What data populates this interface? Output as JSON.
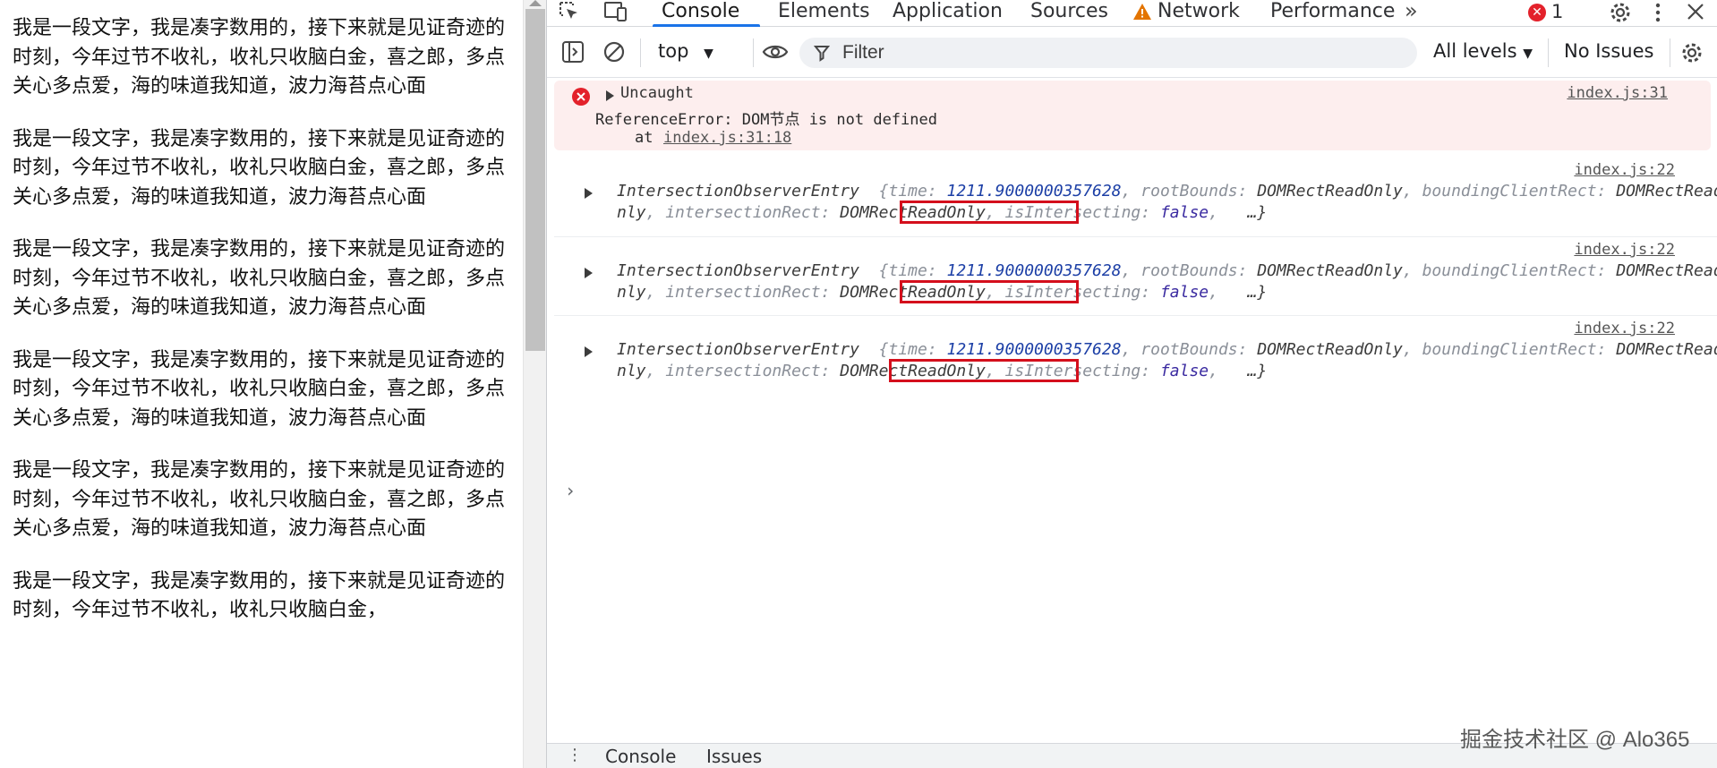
{
  "page": {
    "paragraphs": [
      "我是一段文字，我是凑字数用的，接下来就是见证奇迹的时刻，今年过节不收礼，收礼只收脑白金，喜之郎，多点关心多点爱，海的味道我知道，波力海苔点心面",
      "我是一段文字，我是凑字数用的，接下来就是见证奇迹的时刻，今年过节不收礼，收礼只收脑白金，喜之郎，多点关心多点爱，海的味道我知道，波力海苔点心面",
      "我是一段文字，我是凑字数用的，接下来就是见证奇迹的时刻，今年过节不收礼，收礼只收脑白金，喜之郎，多点关心多点爱，海的味道我知道，波力海苔点心面",
      "我是一段文字，我是凑字数用的，接下来就是见证奇迹的时刻，今年过节不收礼，收礼只收脑白金，喜之郎，多点关心多点爱，海的味道我知道，波力海苔点心面",
      "我是一段文字，我是凑字数用的，接下来就是见证奇迹的时刻，今年过节不收礼，收礼只收脑白金，喜之郎，多点关心多点爱，海的味道我知道，波力海苔点心面",
      "我是一段文字，我是凑字数用的，接下来就是见证奇迹的时刻，今年过节不收礼，收礼只收脑白金，"
    ]
  },
  "devtools": {
    "tabs": [
      {
        "label": "Console",
        "active": true
      },
      {
        "label": "Elements"
      },
      {
        "label": "Application"
      },
      {
        "label": "Sources"
      },
      {
        "label": "Network",
        "warning": true
      },
      {
        "label": "Performance"
      }
    ],
    "more_tabs": "»",
    "error_count": "1",
    "toolbar": {
      "context": "top",
      "filter_placeholder": "Filter",
      "levels": "All levels",
      "issues": "No Issues"
    },
    "error": {
      "title": "Uncaught",
      "message": "ReferenceError: DOM节点 is not defined",
      "at_prefix": "at",
      "at_link": "index.js:31:18",
      "source": "index.js:31"
    },
    "logs": [
      {
        "source": "index.js:22",
        "type_name": "IntersectionObserverEntry",
        "time_key": "time:",
        "time_val": "1211.9000000357628",
        "rootBounds_key": "rootBounds:",
        "rootBounds_val": "DOMRectReadOnly",
        "bcr_key": "boundingClientRect:",
        "bcr_val": "DOMRectReadO",
        "bcr_val2": "nly",
        "ir_key": "intersectionRect:",
        "ir_val": "DOMRectReadOnly",
        "isect_key": "isIntersecting:",
        "isect_val": "false",
        "more": "…}"
      },
      {
        "source": "index.js:22",
        "type_name": "IntersectionObserverEntry",
        "time_key": "time:",
        "time_val": "1211.9000000357628",
        "rootBounds_key": "rootBounds:",
        "rootBounds_val": "DOMRectReadOnly",
        "bcr_key": "boundingClientRect:",
        "bcr_val": "DOMRectReadO",
        "bcr_val2": "nly",
        "ir_key": "intersectionRect:",
        "ir_val": "DOMRectReadOnly",
        "isect_key": "isIntersecting:",
        "isect_val": "false",
        "more": "…}"
      },
      {
        "source": "index.js:22",
        "type_name": "IntersectionObserverEntry",
        "time_key": "time:",
        "time_val": "1211.9000000357628",
        "rootBounds_key": "rootBounds:",
        "rootBounds_val": "DOMRectReadOnly",
        "bcr_key": "boundingClientRect:",
        "bcr_val": "DOMRectReadO",
        "bcr_val2": "nly",
        "ir_key": "intersectionRect:",
        "ir_val": "DOMRectReadOnly",
        "isect_key": "isIntersecting:",
        "isect_val": "false",
        "more": "…}"
      }
    ],
    "prompt": "›",
    "drawer_tabs": [
      "Console",
      "Issues"
    ],
    "watermark": "掘金技术社区 @ Alo365",
    "colors": {
      "accent": "#1a73e8",
      "error": "#e3212b",
      "error_bg": "#fdeeee",
      "highlight_box": "#d40f1c"
    }
  }
}
